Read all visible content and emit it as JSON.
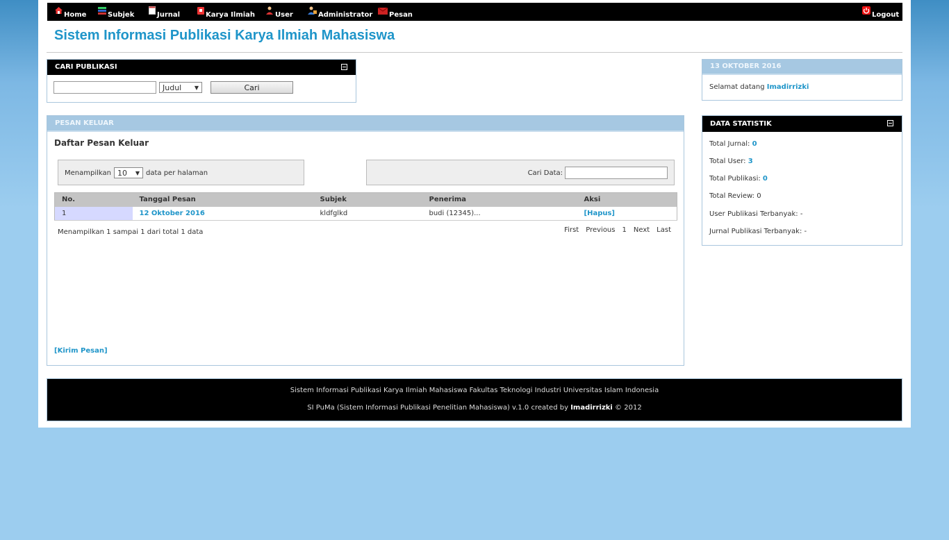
{
  "nav": {
    "items": [
      {
        "label": "Home",
        "icon": "home-icon"
      },
      {
        "label": "Subjek",
        "icon": "list-icon"
      },
      {
        "label": "Jurnal",
        "icon": "document-icon"
      },
      {
        "label": "Karya Ilmiah",
        "icon": "paper-icon"
      },
      {
        "label": "User",
        "icon": "user-icon"
      },
      {
        "label": "Administrator",
        "icon": "admin-icon"
      },
      {
        "label": "Pesan",
        "icon": "mail-icon"
      }
    ],
    "logout": "Logout"
  },
  "header": {
    "title": "Sistem Informasi Publikasi Karya Ilmiah Mahasiswa"
  },
  "search": {
    "title": "CARI PUBLIKASI",
    "input_value": "",
    "field_selected": "Judul",
    "button": "Cari"
  },
  "main": {
    "title": "PESAN KELUAR",
    "subtitle": "Daftar Pesan Keluar",
    "length_prefix": "Menampilkan",
    "length_value": "10",
    "length_suffix": "data per halaman",
    "filter_label": "Cari Data:",
    "filter_value": "",
    "columns": [
      "No.",
      "Tanggal Pesan",
      "Subjek",
      "Penerima",
      "Aksi"
    ],
    "rows": [
      {
        "no": "1",
        "tanggal": "12 Oktober 2016",
        "subjek": "kldfglkd",
        "penerima": "budi (12345)...",
        "aksi": "[Hapus]"
      }
    ],
    "info": "Menampilkan 1 sampai 1 dari total 1 data",
    "pagination": {
      "first": "First",
      "previous": "Previous",
      "page": "1",
      "next": "Next",
      "last": "Last"
    },
    "compose": "[Kirim Pesan]"
  },
  "sidebar": {
    "date_title": "13 OKTOBER 2016",
    "welcome_text": "Selamat datang",
    "welcome_user": "Imadirrizki",
    "stats_title": "DATA STATISTIK",
    "stats": [
      {
        "label": "Total Jurnal:",
        "value": "0",
        "link": true
      },
      {
        "label": "Total User:",
        "value": "3",
        "link": true
      },
      {
        "label": "Total Publikasi:",
        "value": "0",
        "link": true
      },
      {
        "label": "Total Review:",
        "value": "0",
        "link": false
      },
      {
        "label": "User Publikasi Terbanyak:",
        "value": "-",
        "link": false
      },
      {
        "label": "Jurnal Publikasi Terbanyak:",
        "value": "-",
        "link": false
      }
    ]
  },
  "footer": {
    "line1": "Sistem Informasi Publikasi Karya Ilmiah Mahasiswa Fakultas Teknologi Industri Universitas Islam Indonesia",
    "line2_prefix": "SI PuMa (Sistem Informasi Publikasi Penelitian Mahasiswa) v.1.0 created by",
    "line2_author": "Imadirrizki",
    "line2_suffix": "© 2012"
  },
  "colors": {
    "accent": "#1f95c9",
    "nav_bg": "#000000",
    "box_border": "#a9c6dd"
  }
}
